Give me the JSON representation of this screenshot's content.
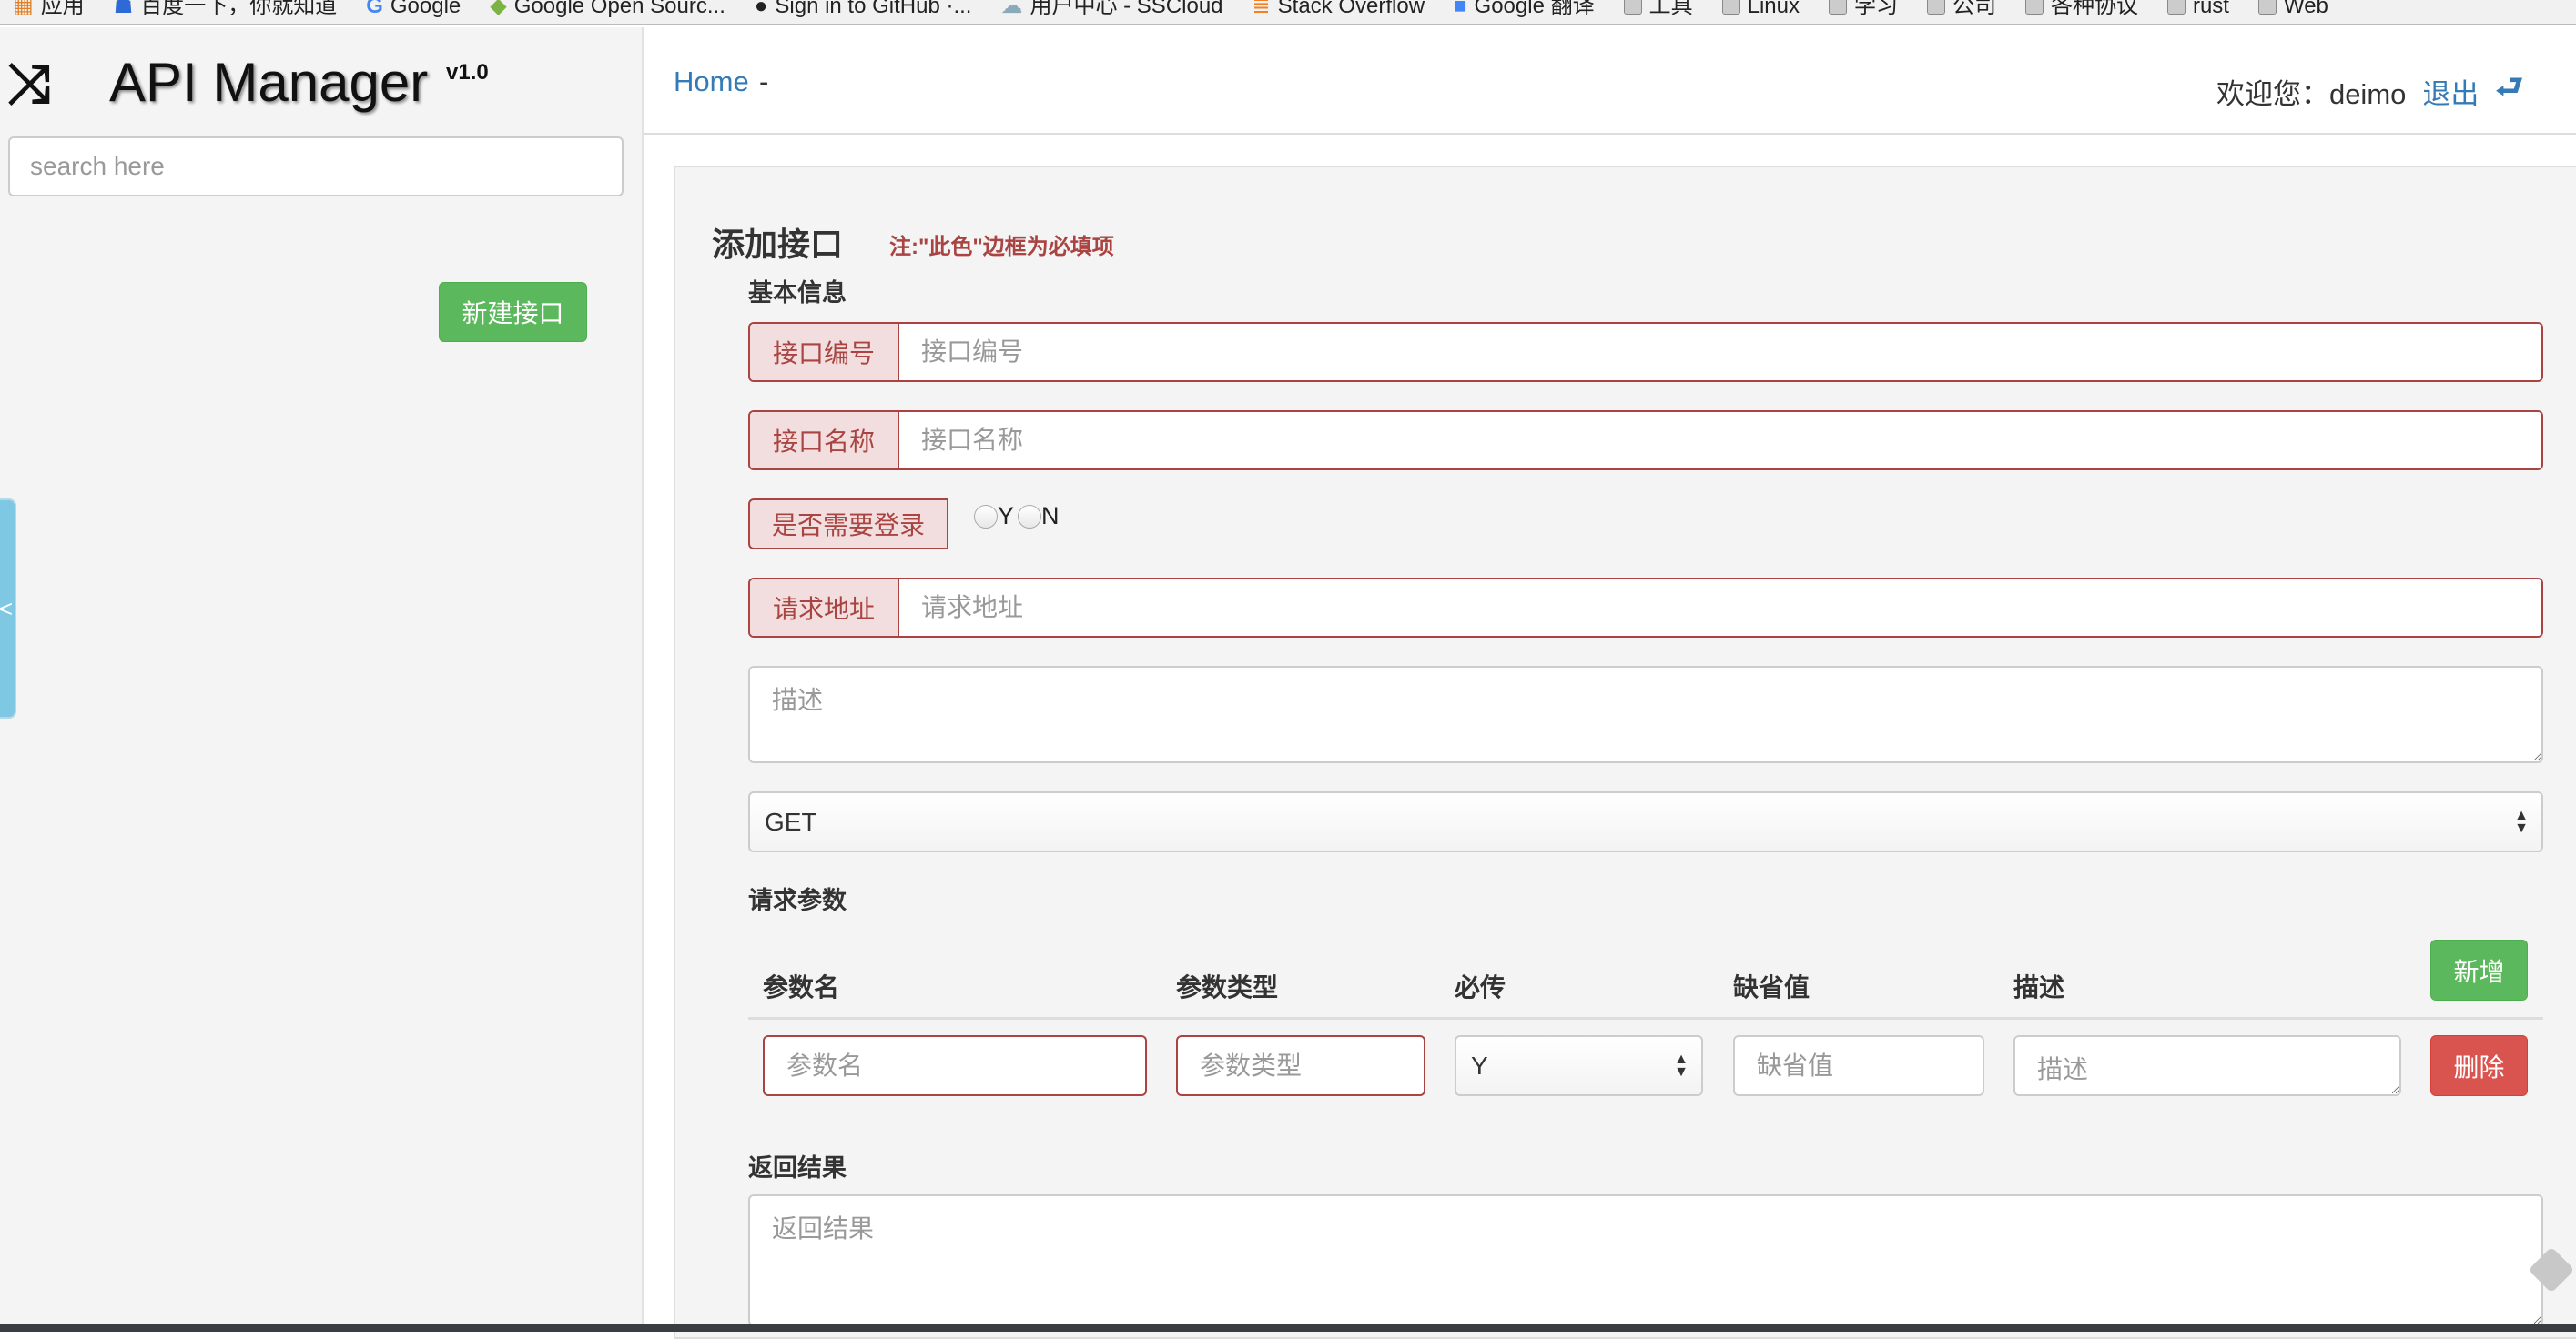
{
  "bookmarks": [
    {
      "label": "应用",
      "icon": "apps-grid-icon"
    },
    {
      "label": "百度一下，你就知道",
      "icon": "baidu-icon"
    },
    {
      "label": "Google",
      "icon": "google-icon"
    },
    {
      "label": "Google Open Sourc...",
      "icon": "google-open-source-icon"
    },
    {
      "label": "Sign in to GitHub ·...",
      "icon": "github-icon"
    },
    {
      "label": "用户中心 - SSCloud",
      "icon": "cloud-icon"
    },
    {
      "label": "Stack Overflow",
      "icon": "stackoverflow-icon"
    },
    {
      "label": "Google 翻译",
      "icon": "google-translate-icon"
    },
    {
      "label": "工具",
      "icon": "folder-icon"
    },
    {
      "label": "Linux",
      "icon": "folder-icon"
    },
    {
      "label": "学习",
      "icon": "folder-icon"
    },
    {
      "label": "公司",
      "icon": "folder-icon"
    },
    {
      "label": "各种协议",
      "icon": "folder-icon"
    },
    {
      "label": "rust",
      "icon": "folder-icon"
    },
    {
      "label": "Web",
      "icon": "folder-icon"
    }
  ],
  "sidebar": {
    "logo_icon": "⤨",
    "title": "API Manager",
    "version": "v1.0",
    "search_placeholder": "search here",
    "new_button": "新建接口",
    "toggle": "<"
  },
  "header": {
    "home": "Home",
    "separator": "-",
    "welcome": "欢迎您：",
    "username": "deimo",
    "logout": "退出",
    "logout_icon": "⮐"
  },
  "form": {
    "title": "添加接口",
    "note": "注:\"此色\"边框为必填项",
    "basic_info": "基本信息",
    "api_no_label": "接口编号",
    "api_no_placeholder": "接口编号",
    "api_name_label": "接口名称",
    "api_name_placeholder": "接口名称",
    "login_label": "是否需要登录",
    "radio_y": "Y",
    "radio_n": "N",
    "url_label": "请求地址",
    "url_placeholder": "请求地址",
    "desc_placeholder": "描述",
    "method": "GET",
    "params_title": "请求参数",
    "params_headers": [
      "参数名",
      "参数类型",
      "必传",
      "缺省值",
      "描述"
    ],
    "add_button": "新增",
    "param_row": {
      "name_placeholder": "参数名",
      "type_placeholder": "参数类型",
      "required": "Y",
      "default_placeholder": "缺省值",
      "desc_placeholder": "描述",
      "delete_button": "删除"
    },
    "result_title": "返回结果",
    "result_placeholder": "返回结果"
  },
  "colors": {
    "required": "#a94442",
    "success": "#5cb85c",
    "danger": "#d9534f",
    "link": "#337ab7"
  }
}
